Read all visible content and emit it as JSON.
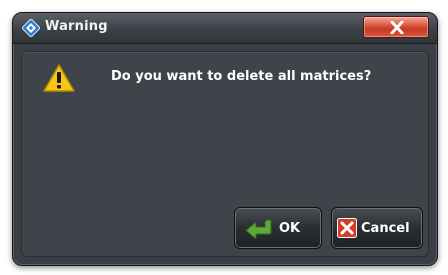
{
  "dialog": {
    "title": "Warning",
    "app_icon": "rohde-schwarz-logo-icon",
    "close_icon": "close-x-icon",
    "message": "Do you want to delete all matrices?",
    "message_icon": "warning-triangle-icon"
  },
  "buttons": {
    "ok": {
      "label": "OK",
      "icon": "enter-arrow-icon"
    },
    "cancel": {
      "label": "Cancel",
      "icon": "cancel-x-icon"
    }
  },
  "colors": {
    "dialog_background": "#3a3f45",
    "close_button": "#d4583f",
    "warning_yellow": "#f5c518",
    "ok_arrow_green": "#5fa83a",
    "cancel_red": "#d63a2a"
  }
}
